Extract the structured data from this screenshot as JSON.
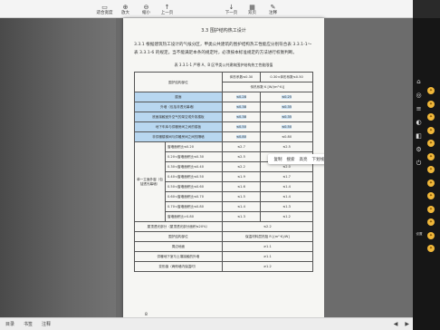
{
  "toolbar": {
    "buttons": [
      {
        "icon": "▭",
        "label": "适合宽度"
      },
      {
        "icon": "⊕",
        "label": "放大"
      },
      {
        "icon": "⊖",
        "label": "缩小"
      },
      {
        "icon": "↑",
        "label": "上一页"
      },
      {
        "icon": "↓",
        "label": "下一页"
      },
      {
        "icon": "▦",
        "label": "双页"
      },
      {
        "icon": "✎",
        "label": "注释"
      }
    ]
  },
  "document": {
    "heading": "3.3  围护结构热工设计",
    "para_label": "3.3.1",
    "para_text": "根据建筑热工设计的气候分区，甲类公共建筑的围护结构热工性能应分别符合表 3.3.1-1～表 3.3.1-6 的规定。当不能满足本条的规定时，必须按本标准规定的方法进行权衡判断。",
    "table_caption": "表 3.3.1-1  严寒 A、B 区甲类公共建筑围护结构热工性能限值",
    "header": [
      "围护结构部位",
      "体形系数≤0.30",
      "0.30<体形系数≤0.50"
    ],
    "header_sub": "传热系数 K [W/(m²·K)]",
    "rows": [
      {
        "label": "屋面",
        "v1": "≤0.28",
        "v2": "≤0.25"
      },
      {
        "label": "外墙（包括非透光幕墙）",
        "v1": "≤0.38",
        "v2": "≤0.35"
      },
      {
        "label": "底面接触室外空气的架空或外挑楼板",
        "v1": "≤0.38",
        "v2": "≤0.35"
      },
      {
        "label": "地下车库与供暖房间之间的楼板",
        "v1": "≤0.50",
        "v2": "≤0.50"
      },
      {
        "label": "非供暖楼梯间与供暖房间之间的隔墙",
        "v1": "≤0.80",
        "v2": "≤0.80"
      }
    ],
    "group_label": "单一立面外窗（包括透光幕墙）",
    "window_rows": [
      {
        "label": "窗墙面积比≤0.20",
        "v1": "≤2.7",
        "v2": "≤2.5"
      },
      {
        "label": "0.20<窗墙面积比≤0.30",
        "v1": "≤2.5",
        "v2": "≤2.3"
      },
      {
        "label": "0.30<窗墙面积比≤0.40",
        "v1": "≤2.2",
        "v2": "≤2.0"
      },
      {
        "label": "0.40<窗墙面积比≤0.50",
        "v1": "≤1.9",
        "v2": "≤1.7"
      },
      {
        "label": "0.50<窗墙面积比≤0.60",
        "v1": "≤1.6",
        "v2": "≤1.4"
      },
      {
        "label": "0.60<窗墙面积比≤0.70",
        "v1": "≤1.5",
        "v2": "≤1.4"
      },
      {
        "label": "0.70<窗墙面积比≤0.80",
        "v1": "≤1.4",
        "v2": "≤1.3"
      },
      {
        "label": "窗墙面积比>0.80",
        "v1": "≤1.3",
        "v2": "≤1.2"
      }
    ],
    "skylight": {
      "label": "屋顶透光部分（屋顶透光部分面积≤20%）",
      "v": "≤2.2"
    },
    "footer_header": {
      "label": "围护结构部位",
      "v": "保温材料层热阻 R [(m²·K)/W]"
    },
    "footer_rows": [
      {
        "label": "周边地面",
        "v": "≥1.1"
      },
      {
        "label": "供暖地下室与土壤接触的外墙",
        "v": "≥1.1"
      },
      {
        "label": "变形缝（两侧墙内保温时）",
        "v": "≥1.2"
      }
    ],
    "page_number": "8"
  },
  "popup": {
    "items": [
      "复制",
      "搜索",
      "高亮",
      "下划线",
      "删除线",
      "添加注释"
    ]
  },
  "right_panel": {
    "label": "设置",
    "buttons": [
      "⌂",
      "◎",
      "≡",
      "◐",
      "◧",
      "⚙",
      "⏻"
    ],
    "dots": [
      "✦",
      "✦",
      "✦",
      "✦",
      "✦",
      "✦",
      "✦",
      "✦",
      "✦",
      "✦",
      "✦",
      "✦",
      "✦"
    ]
  },
  "bottom": {
    "items": [
      "目录",
      "书签",
      "注释"
    ],
    "nav": [
      "◀",
      "▶"
    ]
  }
}
